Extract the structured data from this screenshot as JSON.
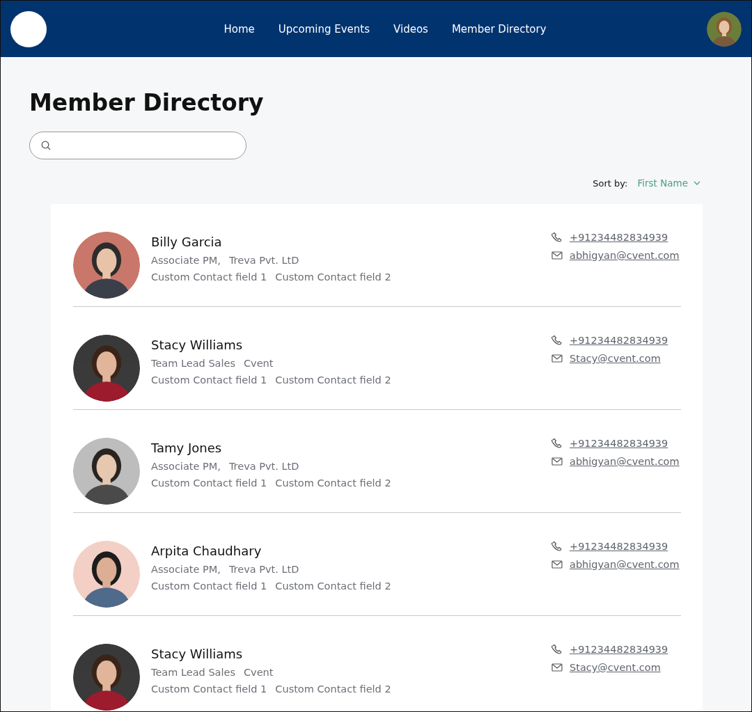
{
  "nav": {
    "links": [
      "Home",
      "Upcoming Events",
      "Videos",
      "Member Directory"
    ],
    "profile": {
      "kind": "picture"
    }
  },
  "page": {
    "title": "Member Directory",
    "sort": {
      "label": "Sort by:",
      "value": "First Name"
    }
  },
  "members": [
    {
      "name": "Billy Garcia",
      "role": "Associate PM,",
      "company": "Treva Pvt. LtD",
      "fields": [
        "Custom Contact field 1",
        "Custom Contact field 2"
      ],
      "phone": "+91234482834939",
      "email": "abhigyan@cvent.com"
    },
    {
      "name": "Stacy Williams",
      "role": "Team Lead Sales",
      "company": "Cvent",
      "fields": [
        "Custom Contact field 1",
        "Custom Contact field 2"
      ],
      "phone": "+91234482834939",
      "email": "Stacy@cvent.com"
    },
    {
      "name": "Tamy Jones",
      "role": "Associate PM,",
      "company": "Treva Pvt. LtD",
      "fields": [
        "Custom Contact field 1",
        "Custom Contact field 2"
      ],
      "phone": "+91234482834939",
      "email": "abhigyan@cvent.com"
    },
    {
      "name": "Arpita Chaudhary",
      "role": "Associate PM,",
      "company": "Treva Pvt. LtD",
      "fields": [
        "Custom Contact field 1",
        "Custom Contact field 2"
      ],
      "phone": "+91234482834939",
      "email": "abhigyan@cvent.com"
    },
    {
      "name": "Stacy Williams",
      "role": "Team Lead Sales",
      "company": "Cvent",
      "fields": [
        "Custom Contact field 1",
        "Custom Contact field 2"
      ],
      "phone": "+91234482834939",
      "email": "Stacy@cvent.com"
    }
  ]
}
